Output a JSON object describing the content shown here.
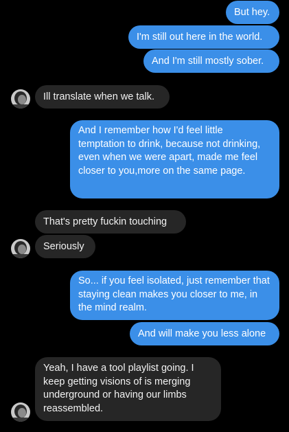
{
  "conversation": {
    "messages": [
      {
        "side": "outgoing",
        "text": "But hey."
      },
      {
        "side": "outgoing",
        "text": "I'm still out here in the world."
      },
      {
        "side": "outgoing",
        "text": "And I'm still mostly sober."
      },
      {
        "side": "incoming",
        "text": "Ill translate when we talk."
      },
      {
        "side": "outgoing",
        "text": "And I remember how I'd feel little temptation to drink, because not drinking, even when we were apart, made me feel closer to you,more on the same page."
      },
      {
        "side": "incoming",
        "text": "That's pretty fuckin touching"
      },
      {
        "side": "incoming",
        "text": "Seriously"
      },
      {
        "side": "outgoing",
        "text": "So... if you feel isolated, just remember that staying clean makes you closer to me, in the mind realm."
      },
      {
        "side": "outgoing",
        "text": "And will make you less alone"
      },
      {
        "side": "incoming",
        "text": "Yeah, I have a tool playlist going. I keep getting visions of is merging underground or having our limbs reassembled."
      }
    ]
  },
  "colors": {
    "background": "#000000",
    "outgoing_bubble": "#3b8fe8",
    "incoming_bubble": "#262626",
    "text": "#ffffff"
  },
  "icons": {
    "avatar": "contact-avatar-photo"
  }
}
